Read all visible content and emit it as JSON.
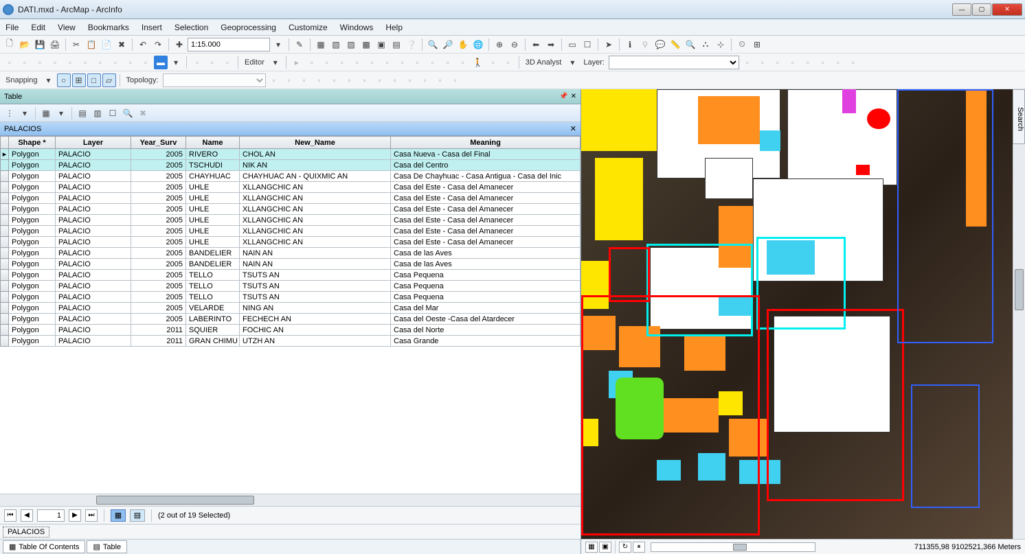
{
  "window": {
    "title": "DATI.mxd - ArcMap - ArcInfo"
  },
  "menu": [
    "File",
    "Edit",
    "View",
    "Bookmarks",
    "Insert",
    "Selection",
    "Geoprocessing",
    "Customize",
    "Windows",
    "Help"
  ],
  "toolbar": {
    "scale": "1:15.000",
    "snapping_label": "Snapping",
    "topology_label": "Topology:",
    "editor_label": "Editor",
    "analyst_label": "3D Analyst",
    "layer_label": "Layer:"
  },
  "table_panel": {
    "title": "Table",
    "layer_name": "PALACIOS",
    "columns": [
      "Shape *",
      "Layer",
      "Year_Surv",
      "Name",
      "New_Name",
      "Meaning"
    ],
    "rows": [
      {
        "shape": "Polygon",
        "layer": "PALACIO",
        "year": "2005",
        "name": "RIVERO",
        "new": "CHOL AN",
        "meaning": "Casa Nueva - Casa del Final",
        "sel": true
      },
      {
        "shape": "Polygon",
        "layer": "PALACIO",
        "year": "2005",
        "name": "TSCHUDI",
        "new": "NIK AN",
        "meaning": "Casa del Centro",
        "sel": true
      },
      {
        "shape": "Polygon",
        "layer": "PALACIO",
        "year": "2005",
        "name": "CHAYHUAC",
        "new": "CHAYHUAC AN - QUIXMIC AN",
        "meaning": "Casa De Chayhuac - Casa Antigua - Casa del Inic",
        "sel": false
      },
      {
        "shape": "Polygon",
        "layer": "PALACIO",
        "year": "2005",
        "name": "UHLE",
        "new": "XLLANGCHIC AN",
        "meaning": "Casa del Este - Casa del Amanecer",
        "sel": false
      },
      {
        "shape": "Polygon",
        "layer": "PALACIO",
        "year": "2005",
        "name": "UHLE",
        "new": "XLLANGCHIC AN",
        "meaning": "Casa del Este - Casa del Amanecer",
        "sel": false
      },
      {
        "shape": "Polygon",
        "layer": "PALACIO",
        "year": "2005",
        "name": "UHLE",
        "new": "XLLANGCHIC AN",
        "meaning": "Casa del Este - Casa del Amanecer",
        "sel": false
      },
      {
        "shape": "Polygon",
        "layer": "PALACIO",
        "year": "2005",
        "name": "UHLE",
        "new": "XLLANGCHIC AN",
        "meaning": "Casa del Este - Casa del Amanecer",
        "sel": false
      },
      {
        "shape": "Polygon",
        "layer": "PALACIO",
        "year": "2005",
        "name": "UHLE",
        "new": "XLLANGCHIC AN",
        "meaning": "Casa del Este - Casa del Amanecer",
        "sel": false
      },
      {
        "shape": "Polygon",
        "layer": "PALACIO",
        "year": "2005",
        "name": "UHLE",
        "new": "XLLANGCHIC AN",
        "meaning": "Casa del Este - Casa del Amanecer",
        "sel": false
      },
      {
        "shape": "Polygon",
        "layer": "PALACIO",
        "year": "2005",
        "name": "BANDELIER",
        "new": "NAIN AN",
        "meaning": "Casa de las Aves",
        "sel": false
      },
      {
        "shape": "Polygon",
        "layer": "PALACIO",
        "year": "2005",
        "name": "BANDELIER",
        "new": "NAIN AN",
        "meaning": "Casa de las Aves",
        "sel": false
      },
      {
        "shape": "Polygon",
        "layer": "PALACIO",
        "year": "2005",
        "name": "TELLO",
        "new": "TSUTS AN",
        "meaning": "Casa Pequena",
        "sel": false
      },
      {
        "shape": "Polygon",
        "layer": "PALACIO",
        "year": "2005",
        "name": "TELLO",
        "new": "TSUTS AN",
        "meaning": "Casa Pequena",
        "sel": false
      },
      {
        "shape": "Polygon",
        "layer": "PALACIO",
        "year": "2005",
        "name": "TELLO",
        "new": "TSUTS AN",
        "meaning": "Casa Pequena",
        "sel": false
      },
      {
        "shape": "Polygon",
        "layer": "PALACIO",
        "year": "2005",
        "name": "VELARDE",
        "new": "NING AN",
        "meaning": "Casa del Mar",
        "sel": false
      },
      {
        "shape": "Polygon",
        "layer": "PALACIO",
        "year": "2005",
        "name": "LABERINTO",
        "new": "FECHECH AN",
        "meaning": "Casa del Oeste -Casa del Atardecer",
        "sel": false
      },
      {
        "shape": "Polygon",
        "layer": "PALACIO",
        "year": "2011",
        "name": "SQUIER",
        "new": "FOCHIC AN",
        "meaning": "Casa del Norte",
        "sel": false
      },
      {
        "shape": "Polygon",
        "layer": "PALACIO",
        "year": "2011",
        "name": "GRAN CHIMU",
        "new": "UTZH AN",
        "meaning": "Casa Grande",
        "sel": false
      }
    ],
    "nav": {
      "position": "1",
      "status": "(2 out of 19 Selected)"
    },
    "layer_tab": "PALACIOS"
  },
  "bottom_tabs": {
    "toc": "Table Of Contents",
    "table": "Table"
  },
  "statusbar": {
    "coords": "711355,98 9102521,366 Meters"
  },
  "search_tab": "Search"
}
